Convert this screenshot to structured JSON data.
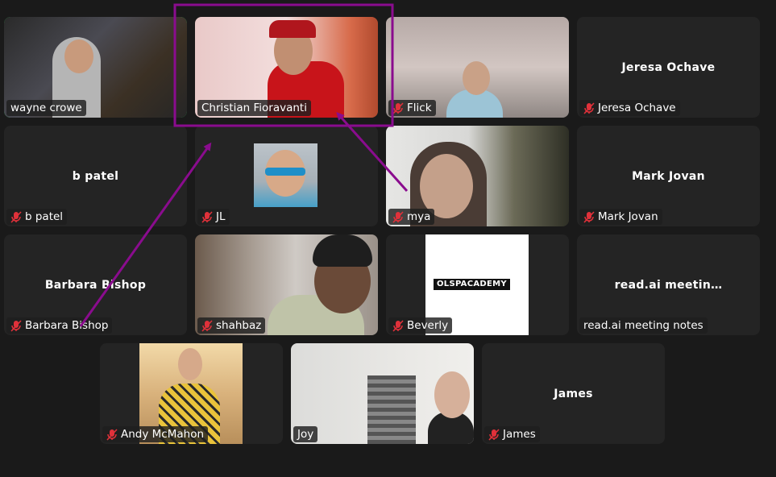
{
  "participants": [
    {
      "name": "wayne crowe",
      "label": "wayne crowe",
      "video": true,
      "muted": false,
      "speaking": true
    },
    {
      "name": "Christian Fioravanti",
      "label": "Christian Fioravanti",
      "video": true,
      "muted": false
    },
    {
      "name": "Flick",
      "label": "Flick",
      "video": true,
      "muted": true
    },
    {
      "name": "Jeresa Ochave",
      "label": "Jeresa Ochave",
      "video": false,
      "muted": true
    },
    {
      "name": "b patel",
      "label": "b patel",
      "video": false,
      "muted": true
    },
    {
      "name": "JL",
      "label": "JL",
      "video": true,
      "muted": true
    },
    {
      "name": "mya",
      "label": "mya",
      "video": true,
      "muted": true
    },
    {
      "name": "Mark Jovan",
      "label": "Mark Jovan",
      "video": false,
      "muted": true
    },
    {
      "name": "Barbara Bishop",
      "label": "Barbara Bishop",
      "video": false,
      "muted": true
    },
    {
      "name": "shahbaz",
      "label": "shahbaz",
      "video": true,
      "muted": true
    },
    {
      "name": "Beverly",
      "label": "Beverly",
      "video": true,
      "muted": true,
      "logo_text": "OLSPACADEMY"
    },
    {
      "name": "read.ai meetin…",
      "label": "read.ai meeting notes",
      "video": false,
      "muted": false
    },
    {
      "name": "Andy McMahon",
      "label": "Andy McMahon",
      "video": true,
      "muted": true
    },
    {
      "name": "Joy",
      "label": "Joy",
      "video": true,
      "muted": false
    },
    {
      "name": "James",
      "label": "James",
      "video": false,
      "muted": true
    }
  ],
  "colors": {
    "speaking_border": "#23d959",
    "annotation": "#8a0c8e",
    "muted_icon": "#e0313a",
    "tile_bg": "#242424"
  },
  "icons": {
    "muted": "mic-muted-icon"
  }
}
